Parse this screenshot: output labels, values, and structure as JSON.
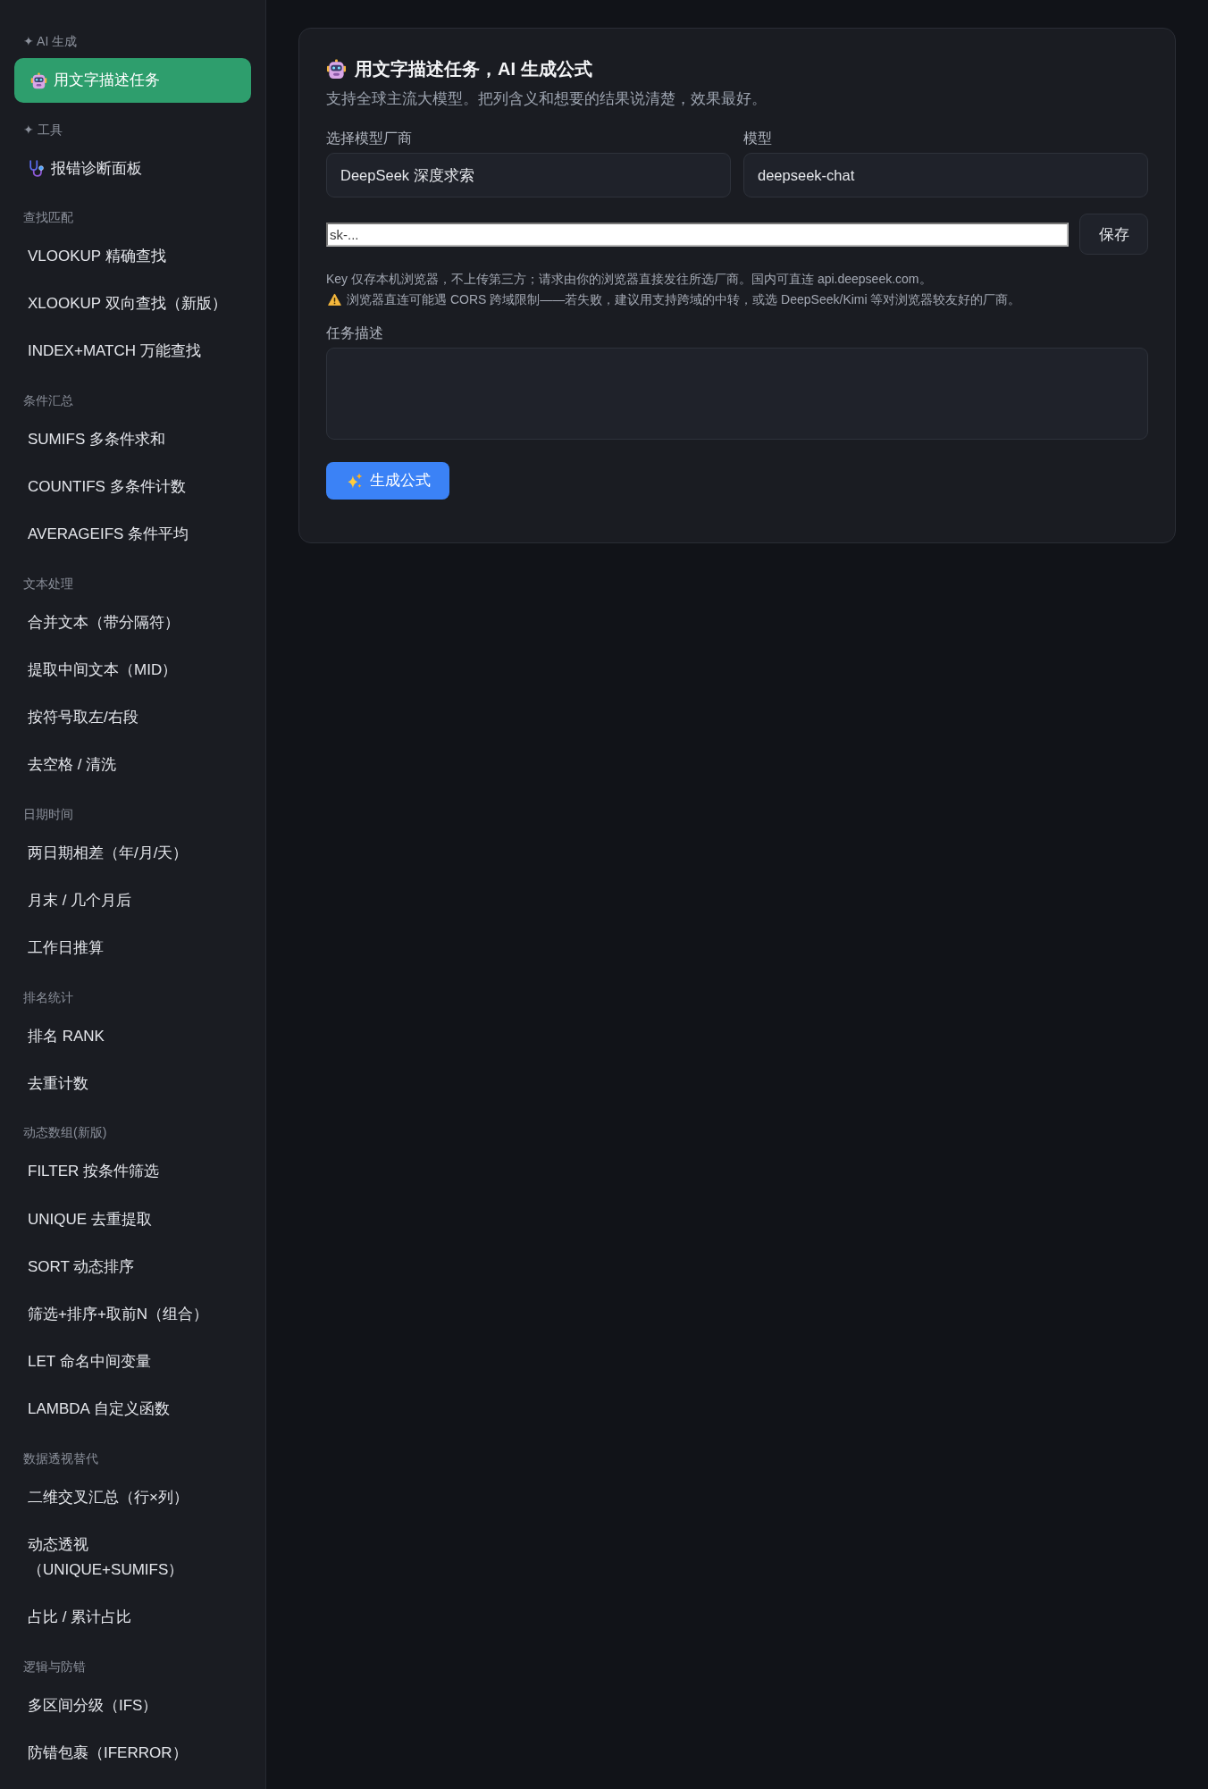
{
  "sidebar": {
    "sections": [
      {
        "title": "✦ AI 生成",
        "items": [
          {
            "label": "用文字描述任务",
            "kind": "generator",
            "selected": true
          }
        ]
      },
      {
        "title": "✦ 工具",
        "items": [
          {
            "label": "报错诊断面板",
            "kind": "diagnostics",
            "selected": false
          }
        ]
      },
      {
        "title": "查找匹配",
        "items": [
          {
            "label": "VLOOKUP 精确查找",
            "kind": "formula",
            "selected": false
          },
          {
            "label": "XLOOKUP 双向查找（新版）",
            "kind": "formula",
            "selected": false
          },
          {
            "label": "INDEX+MATCH 万能查找",
            "kind": "formula",
            "selected": false
          }
        ]
      },
      {
        "title": "条件汇总",
        "items": [
          {
            "label": "SUMIFS 多条件求和",
            "kind": "formula",
            "selected": false
          },
          {
            "label": "COUNTIFS 多条件计数",
            "kind": "formula",
            "selected": false
          },
          {
            "label": "AVERAGEIFS 条件平均",
            "kind": "formula",
            "selected": false
          }
        ]
      },
      {
        "title": "文本处理",
        "items": [
          {
            "label": "合并文本（带分隔符）",
            "kind": "formula",
            "selected": false
          },
          {
            "label": "提取中间文本（MID）",
            "kind": "formula",
            "selected": false
          },
          {
            "label": "按符号取左/右段",
            "kind": "formula",
            "selected": false
          },
          {
            "label": "去空格 / 清洗",
            "kind": "formula",
            "selected": false
          }
        ]
      },
      {
        "title": "日期时间",
        "items": [
          {
            "label": "两日期相差（年/月/天）",
            "kind": "formula",
            "selected": false
          },
          {
            "label": "月末 / 几个月后",
            "kind": "formula",
            "selected": false
          },
          {
            "label": "工作日推算",
            "kind": "formula",
            "selected": false
          }
        ]
      },
      {
        "title": "排名统计",
        "items": [
          {
            "label": "排名 RANK",
            "kind": "formula",
            "selected": false
          },
          {
            "label": "去重计数",
            "kind": "formula",
            "selected": false
          }
        ]
      },
      {
        "title": "动态数组(新版)",
        "items": [
          {
            "label": "FILTER 按条件筛选",
            "kind": "formula",
            "selected": false
          },
          {
            "label": "UNIQUE 去重提取",
            "kind": "formula",
            "selected": false
          },
          {
            "label": "SORT 动态排序",
            "kind": "formula",
            "selected": false
          },
          {
            "label": "筛选+排序+取前N（组合）",
            "kind": "formula",
            "selected": false
          },
          {
            "label": "LET 命名中间变量",
            "kind": "formula",
            "selected": false
          },
          {
            "label": "LAMBDA 自定义函数",
            "kind": "formula",
            "selected": false
          }
        ]
      },
      {
        "title": "数据透视替代",
        "items": [
          {
            "label": "二维交叉汇总（行×列）",
            "kind": "formula",
            "selected": false
          },
          {
            "label": "动态透视（UNIQUE+SUMIFS）",
            "kind": "formula",
            "selected": false
          },
          {
            "label": "占比 / 累计占比",
            "kind": "formula",
            "selected": false
          }
        ]
      },
      {
        "title": "逻辑与防错",
        "items": [
          {
            "label": "多区间分级（IFS）",
            "kind": "formula",
            "selected": false
          },
          {
            "label": "防错包裹（IFERROR）",
            "kind": "formula",
            "selected": false
          }
        ]
      }
    ]
  },
  "card": {
    "title": "用文字描述任务，AI 生成公式",
    "subtitle": "支持全球主流大模型。把列含义和想要的结果说清楚，效果最好。",
    "provider": {
      "label": "选择模型厂商",
      "value": "DeepSeek 深度求索"
    },
    "model": {
      "label": "模型",
      "value": "deepseek-chat"
    },
    "api_key": {
      "placeholder": "sk-..."
    },
    "save_button": "保存",
    "notes": [
      {
        "kind": "info",
        "text": "Key 仅存本机浏览器，不上传第三方；请求由你的浏览器直接发往所选厂商。国内可直连 api.deepseek.com。"
      },
      {
        "kind": "warning",
        "text": "浏览器直连可能遇 CORS 跨域限制——若失败，建议用支持跨域的中转，或选 DeepSeek/Kimi 等对浏览器较友好的厂商。"
      }
    ],
    "task": {
      "label": "任务描述"
    },
    "generate_button": "生成公式"
  }
}
